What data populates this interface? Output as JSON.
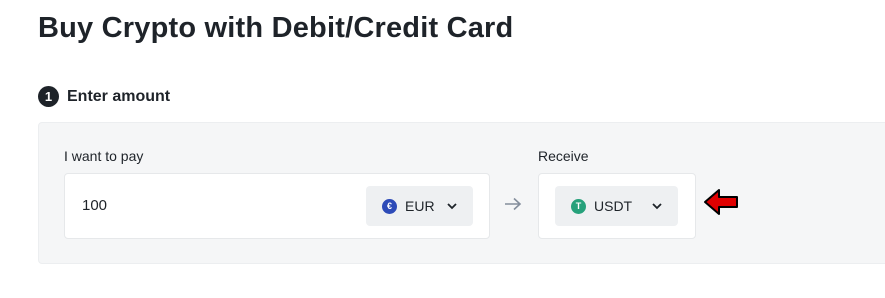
{
  "page": {
    "title": "Buy Crypto with Debit/Credit Card"
  },
  "step": {
    "number": "1",
    "label": "Enter amount"
  },
  "pay": {
    "label": "I want to pay",
    "amount": "100",
    "currency": {
      "code": "EUR",
      "icon": "euro-coin-icon",
      "color": "#2d4bb8",
      "symbol": "€"
    }
  },
  "receive": {
    "label": "Receive",
    "currency": {
      "code": "USDT",
      "icon": "tether-coin-icon",
      "color": "#26a17b",
      "symbol": "T"
    }
  },
  "icons": {
    "arrow": "arrow-right-icon",
    "chevron": "chevron-down-icon",
    "annotation": "red-pointer-arrow"
  },
  "colors": {
    "annotation": "#e00000",
    "panel": "#f5f6f7",
    "select": "#eef0f2"
  }
}
